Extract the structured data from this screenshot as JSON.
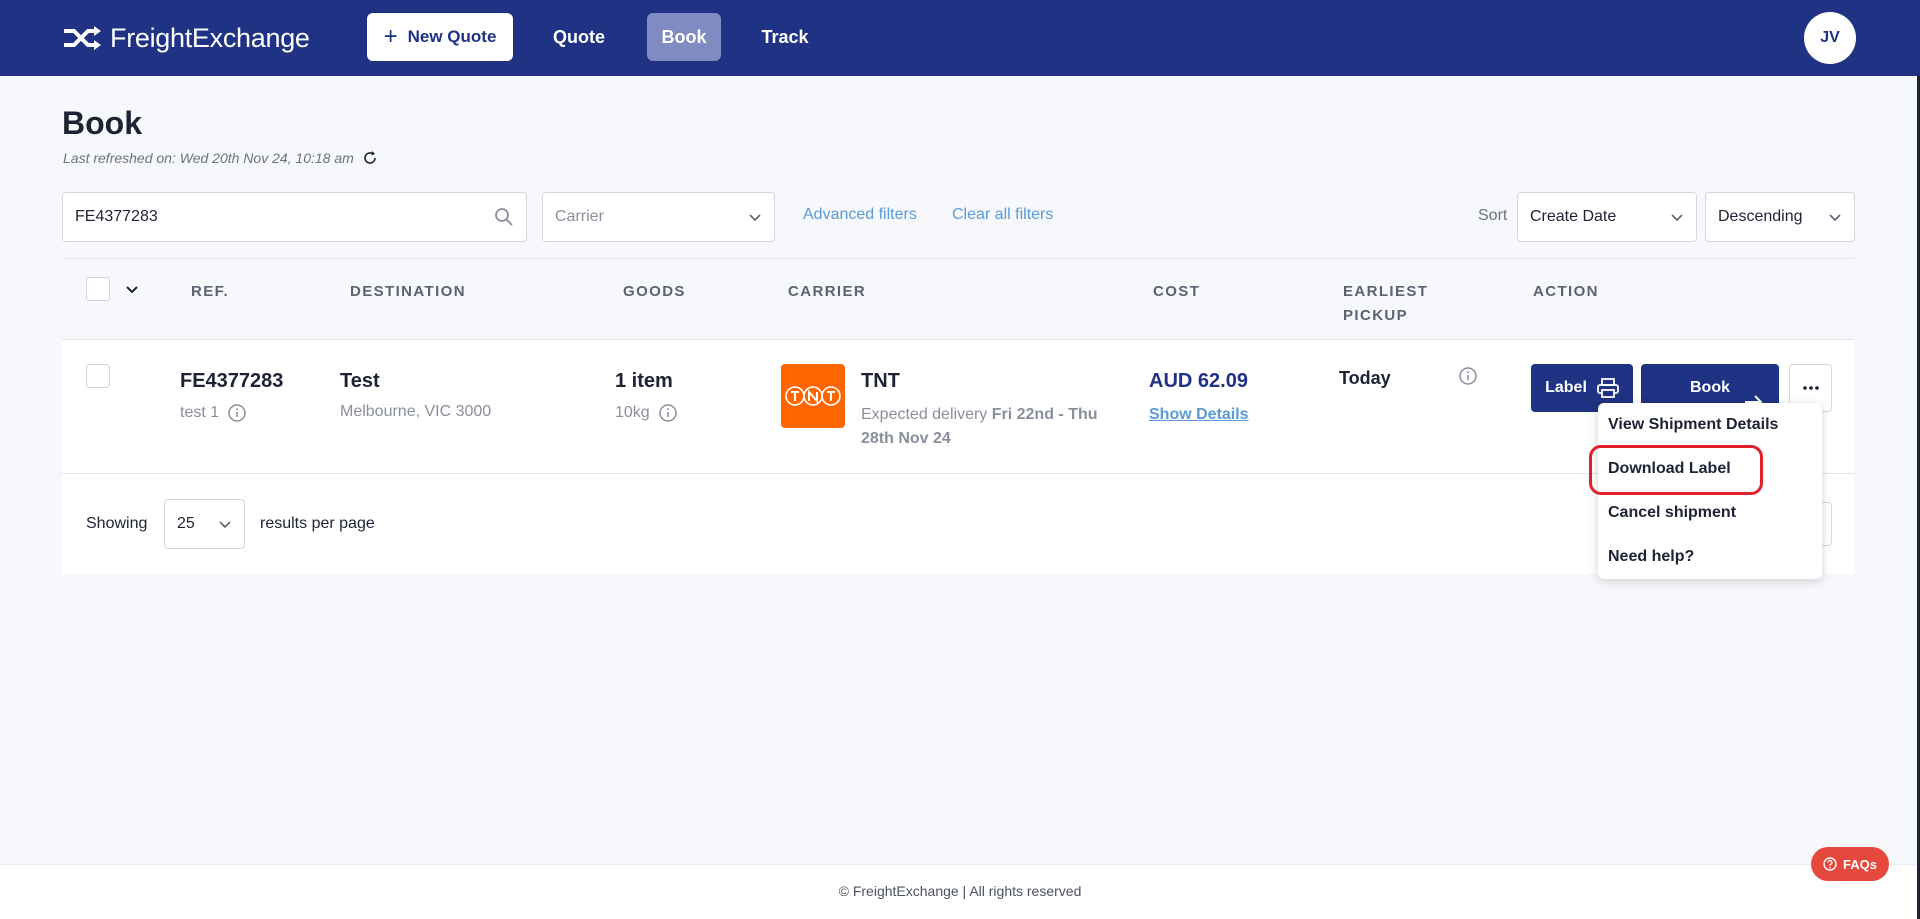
{
  "app": {
    "brand": "FreightExchange"
  },
  "nav": {
    "new_quote": "New Quote",
    "quote": "Quote",
    "book": "Book",
    "track": "Track",
    "avatar_initials": "JV",
    "active": "Book"
  },
  "page": {
    "title": "Book",
    "last_refreshed": "Last refreshed on: Wed 20th Nov 24, 10:18 am"
  },
  "filters": {
    "search_value": "FE4377283",
    "carrier_placeholder": "Carrier",
    "advanced_filters": "Advanced filters",
    "clear_all_filters": "Clear all filters",
    "sort_label": "Sort",
    "sort_field": "Create Date",
    "sort_order": "Descending"
  },
  "table": {
    "headers": {
      "ref": "REF.",
      "destination": "DESTINATION",
      "goods": "GOODS",
      "carrier": "CARRIER",
      "cost": "COST",
      "earliest_pickup": "EARLIEST PICKUP",
      "action": "ACTION"
    },
    "rows": [
      {
        "ref": "FE4377283",
        "ref_sub": "test 1",
        "destination": "Test",
        "destination_sub": "Melbourne, VIC 3000",
        "goods": "1 item",
        "goods_sub": "10kg",
        "carrier": "TNT",
        "carrier_logo_text": "TNT",
        "delivery_prefix": "Expected delivery ",
        "delivery_range": "Fri 22nd - Thu 28th Nov 24",
        "cost": "AUD 62.09",
        "show_details": "Show Details",
        "pickup": "Today",
        "label_button": "Label",
        "book_button": "Book",
        "more_button": "···"
      }
    ]
  },
  "pagination": {
    "showing": "Showing",
    "per_page": "25",
    "results_per_page": "results per page"
  },
  "menu": {
    "items": [
      "View Shipment Details",
      "Download Label",
      "Cancel shipment",
      "Need help?"
    ],
    "highlighted": "Download Label"
  },
  "footer": {
    "copyright": "© FreightExchange | All rights reserved",
    "faq": "FAQs"
  },
  "colors": {
    "brand_navy": "#1f3283",
    "nav_active": "#7f8bc1",
    "link_blue": "#5a9bd5",
    "tnt_orange": "#ff6600",
    "faq_red": "#e5483c",
    "highlight_red": "#e0202a"
  },
  "icons": {
    "logo": "shuffle-arrows-icon",
    "search": "search-icon",
    "refresh": "refresh-icon",
    "chevron": "chevron-down-icon",
    "info": "info-icon",
    "printer": "printer-icon",
    "arrow": "arrow-right-icon",
    "help": "help-icon"
  }
}
